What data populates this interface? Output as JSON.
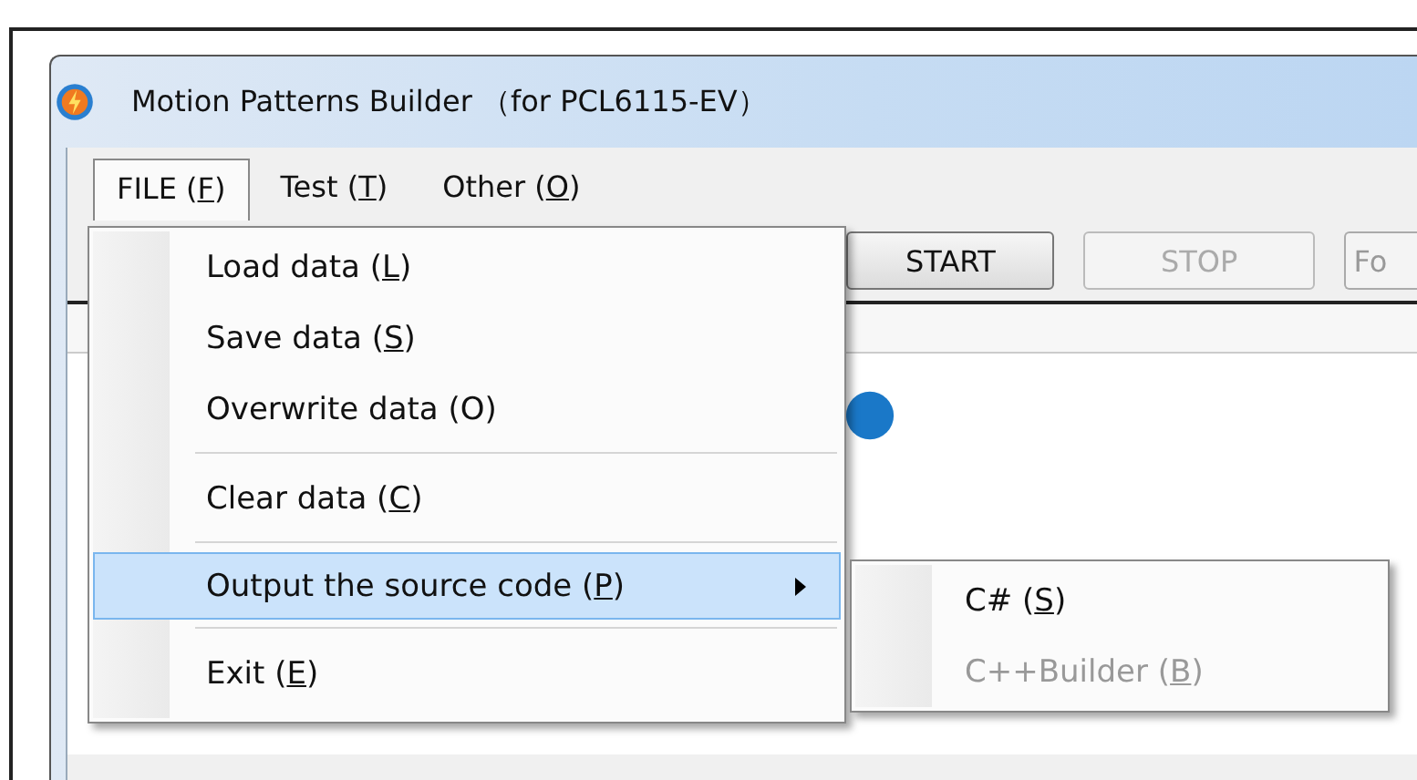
{
  "window": {
    "title": "Motion Patterns Builder （for PCL6115-EV）"
  },
  "menu_bar": [
    {
      "label": "FILE (",
      "access_key": "F",
      "label_end": ")",
      "selected": true
    },
    {
      "label": "Test (",
      "access_key": "T",
      "label_end": ")",
      "selected": false
    },
    {
      "label": "Other (",
      "access_key": "O",
      "label_end": ")",
      "selected": false
    }
  ],
  "toolbar": [
    {
      "label": "START",
      "disabled": false
    },
    {
      "label": "STOP",
      "disabled": true
    },
    {
      "label": "Fo"
    }
  ],
  "file_menu": [
    {
      "kind": "item",
      "label": "Load data (",
      "access_key": "L",
      "label_end": ")",
      "selected": false,
      "submenu": false
    },
    {
      "kind": "item",
      "label": "Save data (",
      "access_key": "S",
      "label_end": ")",
      "selected": false,
      "submenu": false
    },
    {
      "kind": "item",
      "label": "Overwrite data (O)",
      "selected": false,
      "submenu": false
    },
    {
      "kind": "separator"
    },
    {
      "kind": "item",
      "label": "Clear data (",
      "access_key": "C",
      "label_end": ")",
      "selected": false,
      "submenu": false
    },
    {
      "kind": "separator"
    },
    {
      "kind": "item",
      "label": "Output the source code (",
      "access_key": "P",
      "label_end": ")",
      "selected": true,
      "submenu": true
    },
    {
      "kind": "separator"
    },
    {
      "kind": "item",
      "label": "Exit (",
      "access_key": "E",
      "label_end": ")",
      "selected": false,
      "submenu": false
    }
  ],
  "submenu": [
    {
      "kind": "item",
      "label": "C# (",
      "access_key": "S",
      "label_end": ")",
      "disabled": false
    },
    {
      "kind": "item",
      "label": "C++Builder (",
      "access_key": "B",
      "label_end": ")",
      "disabled": true
    }
  ]
}
